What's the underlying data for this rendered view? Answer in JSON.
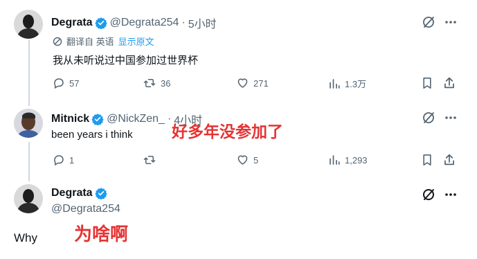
{
  "tweets": [
    {
      "name": "Degrata",
      "handle": "@Degrata254",
      "time": "5小时",
      "translate": {
        "label": "翻译自 英语",
        "show_original": "显示原文"
      },
      "text": "我从未听说过中国参加过世界杯",
      "stats": {
        "replies": "57",
        "reposts": "36",
        "likes": "271",
        "views": "1.3万"
      }
    },
    {
      "name": "Mitnick",
      "handle": "@NickZen_",
      "time": "4小时",
      "text": "been years i think",
      "stats": {
        "replies": "1",
        "reposts": "",
        "likes": "5",
        "views": "1,293"
      },
      "overlay": "好多年没参加了"
    },
    {
      "name": "Degrata",
      "handle": "@Degrata254",
      "text": "Why",
      "overlay": "为啥啊"
    }
  ],
  "colors": {
    "verified": "#1d9bf0",
    "muted": "#536471",
    "link": "#1d9bf0",
    "overlay": "#e53333",
    "thread_line": "#cfd9de"
  },
  "icons": [
    "verified-badge-icon",
    "translate-icon",
    "grok-icon",
    "more-icon",
    "reply-icon",
    "repost-icon",
    "like-icon",
    "views-icon",
    "bookmark-icon",
    "share-icon"
  ]
}
